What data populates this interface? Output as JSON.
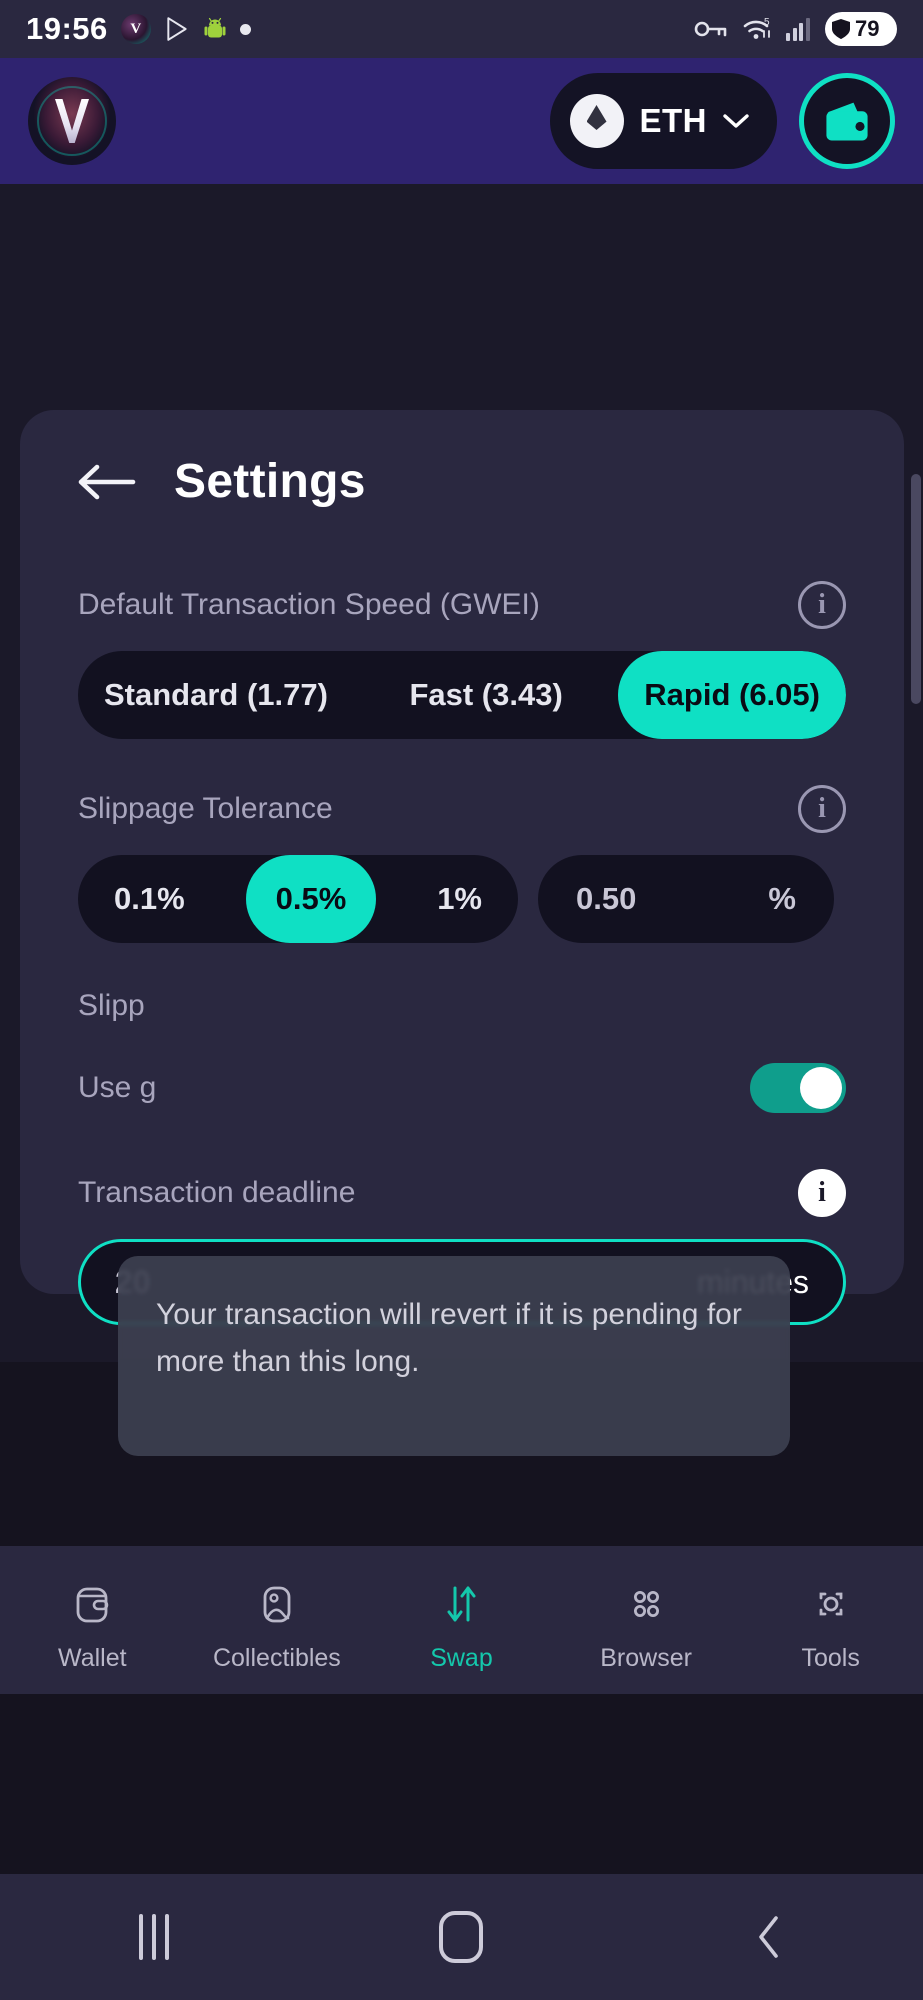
{
  "status_bar": {
    "time": "19:56",
    "battery_percent": "79",
    "wifi_label": "5",
    "icons": [
      "app-v-logo-icon",
      "play-store-icon",
      "android-robot-icon",
      "dot-icon",
      "vpn-key-icon",
      "wifi-icon",
      "cellular-signal-icon",
      "battery-icon"
    ]
  },
  "app_header": {
    "brand": "brand-logo-icon",
    "chain": {
      "symbol": "ETH",
      "token_icon": "ethereum-icon",
      "chevron": "chevron-down-icon"
    },
    "wallet_button": "wallet-icon"
  },
  "settings": {
    "title": "Settings",
    "back_icon": "arrow-left-icon",
    "sections": {
      "speed": {
        "label": "Default Transaction Speed (GWEI)",
        "info_icon": "info-icon",
        "options": [
          {
            "label": "Standard (1.77)",
            "selected": false
          },
          {
            "label": "Fast (3.43)",
            "selected": false
          },
          {
            "label": "Rapid (6.05)",
            "selected": true
          }
        ]
      },
      "slippage": {
        "label": "Slippage Tolerance",
        "info_icon": "info-icon",
        "options": [
          {
            "label": "0.1%",
            "selected": false
          },
          {
            "label": "0.5%",
            "selected": true
          },
          {
            "label": "1%",
            "selected": false
          }
        ],
        "custom_value": "0.50",
        "custom_unit": "%"
      },
      "slippage_obscured": {
        "label": "Slipp",
        "note": "partially covered by tooltip"
      },
      "gas_toggle": {
        "label": "Use g",
        "note": "partially covered by tooltip",
        "enabled": true
      },
      "deadline": {
        "label": "Transaction deadline",
        "info_icon": "info-icon",
        "value": "20",
        "unit": "minutes"
      }
    }
  },
  "tooltip": {
    "text": "Your transaction will revert if it is pending for more than this long."
  },
  "bottom_nav": {
    "items": [
      {
        "label": "Wallet",
        "icon": "wallet-icon",
        "active": false
      },
      {
        "label": "Collectibles",
        "icon": "image-icon",
        "active": false
      },
      {
        "label": "Swap",
        "icon": "swap-arrows-icon",
        "active": true
      },
      {
        "label": "Browser",
        "icon": "grid-icon",
        "active": false
      },
      {
        "label": "Tools",
        "icon": "scan-icon",
        "active": false
      }
    ]
  },
  "system_nav": {
    "recents": "recents-icon",
    "home": "home-icon",
    "back": "back-icon"
  },
  "colors": {
    "accent": "#0fe0c4",
    "header_purple": "#2f2370",
    "card": "#2a2840",
    "page_bg": "#1b1929",
    "input_bg": "#121120",
    "muted_text": "#a8a5bd"
  }
}
